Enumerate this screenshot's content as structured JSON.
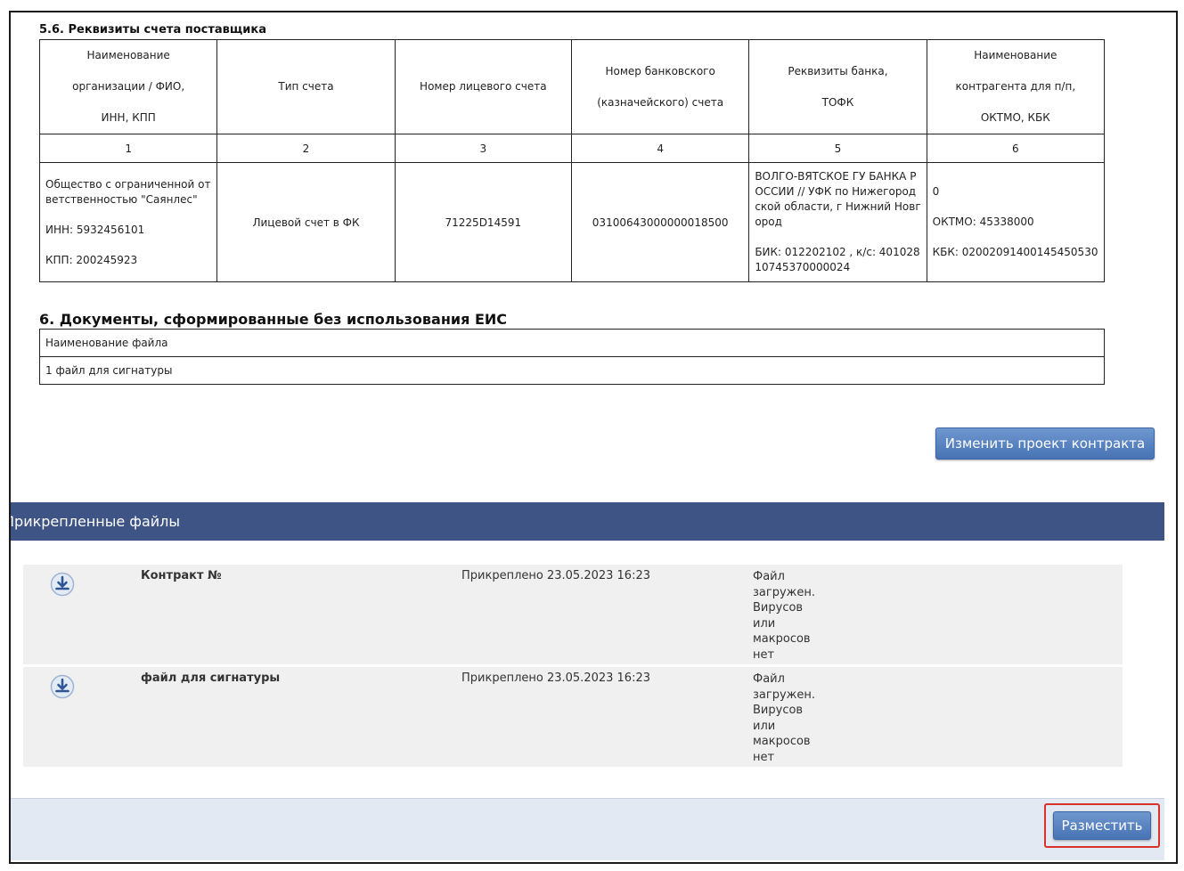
{
  "section56": {
    "title": "5.6. Реквизиты счета поставщика",
    "headers": [
      [
        "Наименование",
        "организации / ФИО,",
        "ИНН, КПП"
      ],
      [
        "Тип счета"
      ],
      [
        "Номер лицевого счета"
      ],
      [
        "Номер банковского",
        "(казначейского) счета"
      ],
      [
        "Реквизиты банка,",
        "ТОФК"
      ],
      [
        "Наименование",
        "контрагента для п/п,",
        "ОКТМО, КБК"
      ]
    ],
    "numbers": [
      "1",
      "2",
      "3",
      "4",
      "5",
      "6"
    ],
    "row": {
      "org_name": "Общество с ограниченной ответственностью \"Саянлес\"",
      "inn": "ИНН: 5932456101",
      "kpp": "КПП: 200245923",
      "account_type": "Лицевой счет в ФК",
      "personal_account": "71225D14591",
      "bank_account": "03100643000000018500",
      "bank_name": "ВОЛГО-ВЯТСКОЕ ГУ БАНКА РОССИИ // УФК по Нижегородской области, г Нижний Новгород",
      "bik": "БИК: 012202102 , к/с: 40102810745370000024",
      "counterparty": "0",
      "oktmo": "ОКТМО: 45338000",
      "kbk": "КБК: 02002091400145450530"
    }
  },
  "section6": {
    "title": "6. Документы, сформированные без использования ЕИС",
    "header": "Наименование файла",
    "rows": [
      "1 файл для сигнатуры"
    ]
  },
  "edit_button": "Изменить проект контракта",
  "attached": {
    "title": "Прикрепленные файлы",
    "files": [
      {
        "name": "Контракт №",
        "date": "Прикреплено 23.05.2023 16:23",
        "status": "Файл загружен. Вирусов или макросов нет",
        "icon": "download-icon"
      },
      {
        "name": "файл для сигнатуры",
        "date": "Прикреплено 23.05.2023 16:23",
        "status": "Файл загружен. Вирусов или макросов нет",
        "icon": "download-icon"
      }
    ]
  },
  "place_button": "Разместить",
  "colors": {
    "panel_header": "#3e5485",
    "button": "#5682c2",
    "highlight": "#d9322b",
    "footer": "#e2e9f2"
  }
}
